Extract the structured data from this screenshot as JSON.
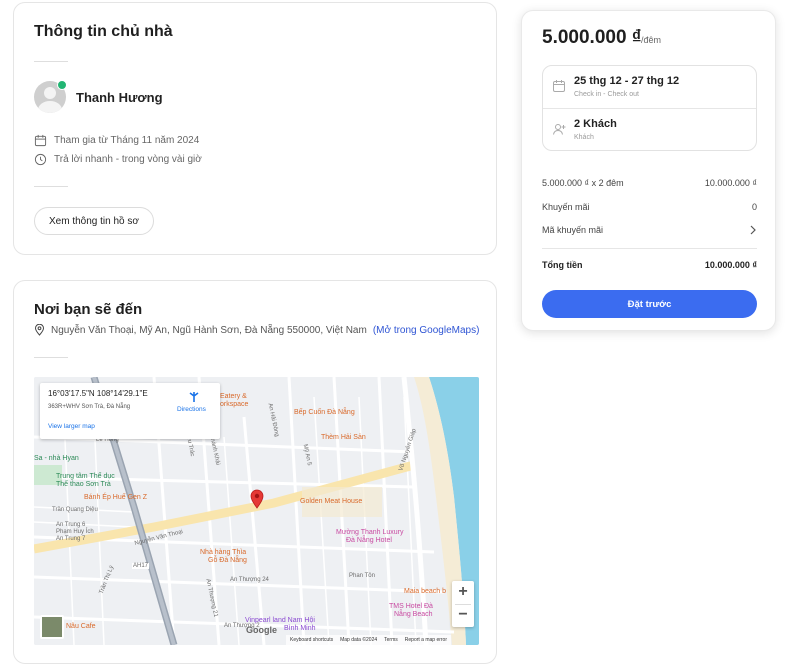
{
  "host": {
    "title": "Thông tin chủ nhà",
    "name": "Thanh Hương",
    "joined": "Tham gia từ Tháng 11 năm 2024",
    "response": "Trả lời nhanh - trong vòng vài giờ",
    "profile_button": "Xem thông tin hồ sơ"
  },
  "location": {
    "title": "Nơi bạn sẽ đến",
    "address": "Nguyễn Văn Thoại, Mỹ An, Ngũ Hành Sơn, Đà Nẵng 550000, Việt Nam",
    "maps_link": "(Mở trong GoogleMaps)",
    "map": {
      "coords": "16°03'17.5\"N 108°14'29.1\"E",
      "plus_code": "363R+WHV Sơn Trà, Đà Nẵng",
      "directions": "Directions",
      "view_larger": "View larger map",
      "zoom_in": "+",
      "zoom_out": "−",
      "footer": [
        "Keyboard shortcuts",
        "Map data ©2024",
        "Terms",
        "Report a map error"
      ],
      "logo": "Google",
      "labels": {
        "eatery": "Eatery &",
        "workspace": "orkspace",
        "bep_cuon": "Bếp Cuốn Đà Nẵng",
        "them_hai_san": "Thèm Hải Sản",
        "trung_tam": "Trung tâm Thể dục",
        "the_thao": "Thể thao Sơn Trà",
        "sa_nha_hyan": "Sa - nhà Hyan",
        "banh_ep": "Bánh Ép Huế Gen Z",
        "golden_meat": "Golden Meat House",
        "muong_thanh": "Mường Thanh Luxury",
        "da_nang_hotel": "Đà Nẵng Hotel",
        "nha_hang_thia": "Nhà hàng Thìa",
        "go_da_nang": "Gỗ Đà Nẵng",
        "maia": "Maia beach b",
        "tms_hotel": "TMS Hotel Đà",
        "nang_beach": "Nẵng Beach",
        "vinpearl": "Vinpearl land Nam Hội",
        "binh_minh": "Bình Minh",
        "nau_cafe": "Nâu Cafe",
        "le_hong": "Lê Hồng",
        "tran_quang_dieu": "Trần Quang Diệu",
        "an_trung_6": "An Trung 6",
        "pham_huy_ich": "Phạm Huy Ích",
        "an_trung_7": "An Trung 7",
        "nguyen_van_thoai": "Nguyễn Văn Thoại",
        "ah17": "AH17",
        "tran_thi_ly": "Trần Thị Lý",
        "an_thuong_24": "An Thượng 24",
        "an_thuong_21": "An Thượng 21",
        "an_thuong_2": "An Thượng 2",
        "pham_ton": "Phan Tôn",
        "vo_nguyen_giap": "Võ Nguyên Giáp",
        "an_hai_dong": "An Hải Đông",
        "my_an_5": "Mỹ An 5",
        "le_huu_trac": "Lê Hữu Trác",
        "le_thanh_khai": "Lê Thành Khải"
      }
    }
  },
  "booking": {
    "price": "5.000.000 ₫",
    "per_night": "/đêm",
    "dates": "25 thg 12 - 27 thg 12",
    "dates_sub": "Check in - Check out",
    "guests": "2 Khách",
    "guests_sub": "Khách",
    "nightly_label": "5.000.000 ₫ x 2 đêm",
    "nightly_value": "10.000.000 ₫",
    "discount_label": "Khuyến mãi",
    "discount_value": "0",
    "promo_label": "Mã khuyến mãi",
    "total_label": "Tổng tiền",
    "total_value": "10.000.000 ₫",
    "book_button": "Đặt trước"
  },
  "colors": {
    "accent": "#3b6cf0",
    "verified": "#22b573",
    "link": "#2f55d4"
  },
  "icons": [
    "calendar-icon",
    "clock-icon",
    "map-pin-icon",
    "guests-icon",
    "chevron-right-icon",
    "directions-icon",
    "map-marker-icon"
  ]
}
